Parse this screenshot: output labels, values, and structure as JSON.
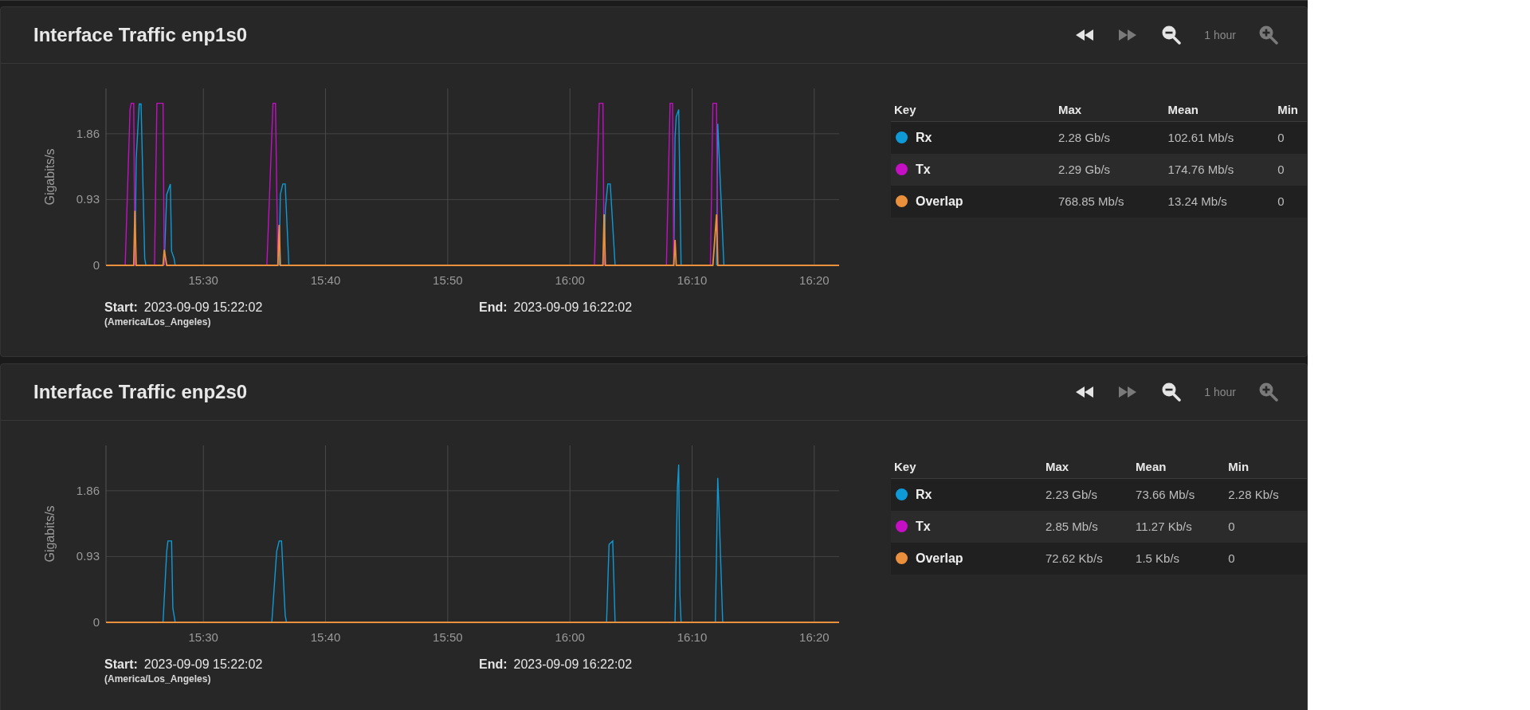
{
  "panels": [
    {
      "title": "Interface Traffic enp1s0",
      "controls": [
        {
          "kind": "rewind",
          "disabled": false
        },
        {
          "kind": "forward",
          "disabled": true
        },
        {
          "kind": "zoom_out",
          "disabled": false
        },
        {
          "kind": "range",
          "text": "1 hour"
        },
        {
          "kind": "zoom_in",
          "disabled": true
        }
      ],
      "chart_data": {
        "type": "line",
        "ylabel": "Gigabits/s",
        "xlim": [
          922.03,
          982.03
        ],
        "ylim": [
          0,
          2.5
        ],
        "yticks": [
          0,
          0.93,
          1.86
        ],
        "grid": true,
        "xticks": [
          {
            "value": 930,
            "label": "15:30"
          },
          {
            "value": 940,
            "label": "15:40"
          },
          {
            "value": 950,
            "label": "15:50"
          },
          {
            "value": 960,
            "label": "16:00"
          },
          {
            "value": 970,
            "label": "16:10"
          },
          {
            "value": 980,
            "label": "16:20"
          }
        ],
        "x": [
          922.03,
          923.6,
          924.0,
          924.1,
          924.3,
          924.4,
          924.5,
          924.75,
          924.9,
          925.2,
          925.3,
          926.0,
          926.2,
          926.7,
          926.8,
          927.0,
          927.3,
          927.4,
          927.6,
          927.7,
          935.2,
          935.7,
          935.9,
          936.1,
          936.2,
          936.3,
          936.5,
          936.7,
          937.0,
          962.0,
          962.4,
          962.7,
          962.8,
          962.9,
          963.1,
          963.3,
          963.7,
          967.9,
          968.2,
          968.4,
          968.5,
          968.6,
          968.7,
          968.9,
          969.1,
          971.5,
          971.7,
          972.0,
          972.1,
          972.2,
          972.6,
          982.03
        ],
        "series": [
          {
            "name": "Rx",
            "color": "#0e9ad7",
            "values": [
              null,
              null,
              null,
              null,
              null,
              0,
              1.5,
              2.28,
              2.28,
              0.1,
              0,
              null,
              null,
              null,
              0,
              1.0,
              1.15,
              0.2,
              0.1,
              0,
              null,
              null,
              null,
              null,
              0,
              1.0,
              1.15,
              1.15,
              0,
              null,
              null,
              null,
              0,
              0.8,
              1.15,
              1.15,
              0,
              null,
              null,
              null,
              0,
              1.8,
              2.1,
              2.2,
              0,
              null,
              null,
              0,
              2.0,
              1.6,
              0,
              null
            ]
          },
          {
            "name": "Tx",
            "color": "#c40fc4",
            "values": [
              null,
              0,
              2.2,
              2.29,
              2.29,
              0,
              null,
              null,
              null,
              null,
              null,
              0,
              2.29,
              2.29,
              0,
              null,
              null,
              null,
              null,
              null,
              0,
              2.29,
              2.29,
              0,
              null,
              null,
              null,
              null,
              null,
              0,
              2.29,
              2.29,
              0,
              null,
              null,
              null,
              null,
              0,
              2.29,
              2.29,
              0,
              null,
              null,
              null,
              null,
              0,
              2.29,
              2.29,
              0,
              null,
              null,
              null
            ]
          },
          {
            "name": "Overlap",
            "color": "#ea8f3c",
            "values": [
              0,
              0,
              0,
              0,
              0,
              0.77,
              0,
              0,
              0,
              0,
              0,
              0,
              0,
              0,
              0.22,
              0,
              0,
              0,
              0,
              0,
              0,
              0,
              0,
              0,
              0.57,
              0,
              0,
              0,
              0,
              0,
              0,
              0,
              0.72,
              0,
              0,
              0,
              0,
              0,
              0,
              0,
              0,
              0.36,
              0,
              0,
              0,
              0,
              0,
              0.72,
              0,
              0,
              0,
              0
            ]
          }
        ]
      },
      "start": {
        "label": "Start:",
        "value": "2023-09-09 15:22:02",
        "timezone": "(America/Los_Angeles)"
      },
      "end": {
        "label": "End:",
        "value": "2023-09-09 16:22:02"
      },
      "legend": {
        "columns": [
          "Key",
          "Max",
          "Mean",
          "Min"
        ],
        "rows": [
          {
            "max": "2.28 Gb/s",
            "mean": "102.61 Mb/s",
            "min": "0"
          },
          {
            "max": "2.29 Gb/s",
            "mean": "174.76 Mb/s",
            "min": "0"
          },
          {
            "max": "768.85 Mb/s",
            "mean": "13.24 Mb/s",
            "min": "0"
          }
        ]
      }
    },
    {
      "title": "Interface Traffic enp2s0",
      "controls": [
        {
          "kind": "rewind",
          "disabled": false
        },
        {
          "kind": "forward",
          "disabled": true
        },
        {
          "kind": "zoom_out",
          "disabled": false
        },
        {
          "kind": "range",
          "text": "1 hour"
        },
        {
          "kind": "zoom_in",
          "disabled": true
        }
      ],
      "chart_data": {
        "type": "line",
        "ylabel": "Gigabits/s",
        "xlim": [
          922.03,
          982.03
        ],
        "ylim": [
          0,
          2.5
        ],
        "yticks": [
          0,
          0.93,
          1.86
        ],
        "grid": true,
        "xticks": [
          {
            "value": 930,
            "label": "15:30"
          },
          {
            "value": 940,
            "label": "15:40"
          },
          {
            "value": 950,
            "label": "15:50"
          },
          {
            "value": 960,
            "label": "16:00"
          },
          {
            "value": 970,
            "label": "16:10"
          },
          {
            "value": 980,
            "label": "16:20"
          }
        ],
        "x": [
          922.03,
          926.7,
          927.0,
          927.1,
          927.4,
          927.5,
          927.6,
          927.7,
          935.6,
          936.0,
          936.2,
          936.4,
          936.7,
          936.8,
          963.0,
          963.2,
          963.5,
          963.7,
          968.6,
          968.8,
          968.9,
          969.0,
          969.1,
          971.9,
          972.1,
          972.2,
          972.5,
          982.03
        ],
        "series": [
          {
            "name": "Rx",
            "color": "#0e9ad7",
            "values": [
              null,
              0,
              1.0,
              1.15,
              1.15,
              0.2,
              0.1,
              0,
              0,
              1.0,
              1.15,
              1.15,
              0.1,
              0,
              0,
              1.1,
              1.15,
              0,
              0,
              1.9,
              2.23,
              0.4,
              0,
              0,
              2.04,
              1.6,
              0,
              null
            ]
          },
          {
            "name": "Tx",
            "color": "#c40fc4",
            "values": [
              null,
              null,
              null,
              null,
              null,
              null,
              null,
              null,
              null,
              null,
              null,
              null,
              null,
              null,
              null,
              null,
              null,
              null,
              null,
              null,
              null,
              null,
              null,
              null,
              null,
              null,
              null,
              null
            ]
          },
          {
            "name": "Overlap",
            "color": "#ea8f3c",
            "values": [
              0,
              0,
              0,
              0,
              0,
              0,
              0,
              0,
              0,
              0,
              0,
              0,
              0,
              0,
              0,
              0,
              0,
              0,
              0,
              0,
              0,
              0,
              0,
              0,
              0,
              0,
              0,
              0
            ]
          }
        ]
      },
      "start": {
        "label": "Start:",
        "value": "2023-09-09 15:22:02",
        "timezone": "(America/Los_Angeles)"
      },
      "end": {
        "label": "End:",
        "value": "2023-09-09 16:22:02"
      },
      "legend": {
        "columns": [
          "Key",
          "Max",
          "Mean",
          "Min"
        ],
        "rows": [
          {
            "max": "2.23 Gb/s",
            "mean": "73.66 Mb/s",
            "min": "2.28 Kb/s"
          },
          {
            "max": "2.85 Mb/s",
            "mean": "11.27 Kb/s",
            "min": "0"
          },
          {
            "max": "72.62 Kb/s",
            "mean": "1.5 Kb/s",
            "min": "0"
          }
        ]
      }
    }
  ]
}
